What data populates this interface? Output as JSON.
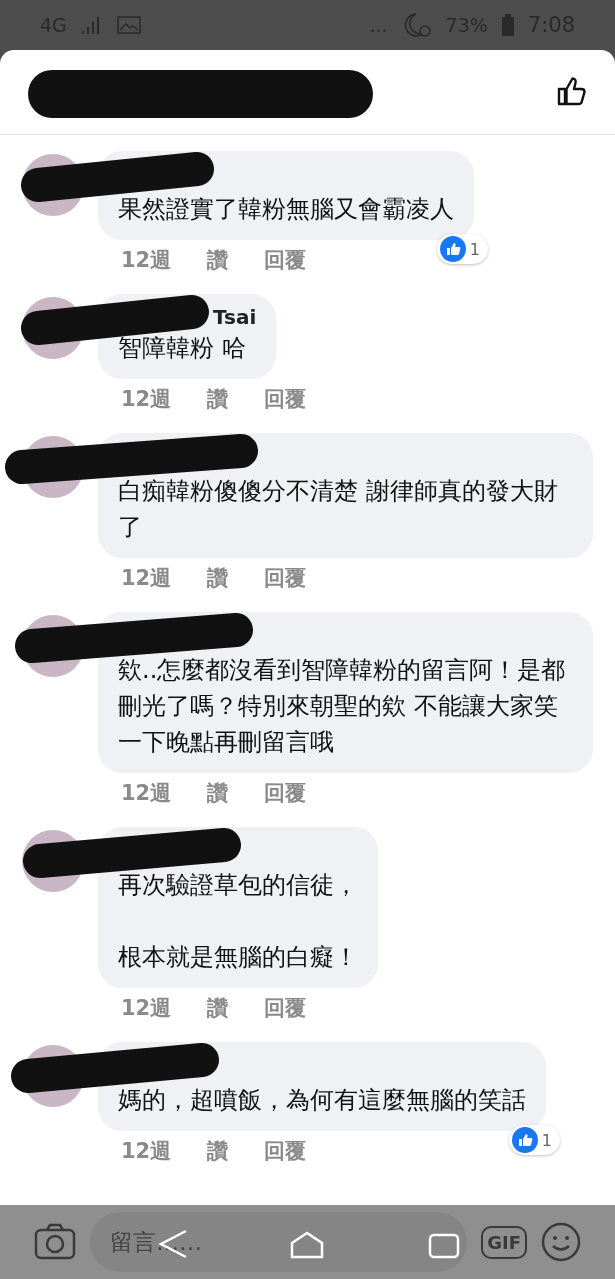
{
  "status_bar": {
    "network": "4G",
    "more": "...",
    "battery": "73%",
    "time": "7:08"
  },
  "comments": [
    {
      "paragraphs": [
        "果然證實了韓粉無腦又會霸凌人"
      ],
      "time": "12週",
      "like": "讚",
      "reply": "回覆",
      "reaction_count": "1"
    },
    {
      "name": "Tsai",
      "paragraphs": [
        "智障韓粉 哈"
      ],
      "time": "12週",
      "like": "讚",
      "reply": "回覆"
    },
    {
      "paragraphs": [
        "白痴韓粉傻傻分不清楚 謝律師真的發大財了"
      ],
      "time": "12週",
      "like": "讚",
      "reply": "回覆"
    },
    {
      "paragraphs": [
        "欸..怎麼都沒看到智障韓粉的留言阿！是都刪光了嗎？特別來朝聖的欸 不能讓大家笑一下晚點再刪留言哦"
      ],
      "time": "12週",
      "like": "讚",
      "reply": "回覆"
    },
    {
      "paragraphs": [
        "再次驗證草包的信徒，",
        "根本就是無腦的白癡！"
      ],
      "time": "12週",
      "like": "讚",
      "reply": "回覆"
    },
    {
      "paragraphs": [
        "媽的，超噴飯，為何有這麼無腦的笑話"
      ],
      "time": "12週",
      "like": "讚",
      "reply": "回覆",
      "reaction_count": "1"
    }
  ],
  "composer": {
    "placeholder": "留言……",
    "gif": "GIF"
  }
}
